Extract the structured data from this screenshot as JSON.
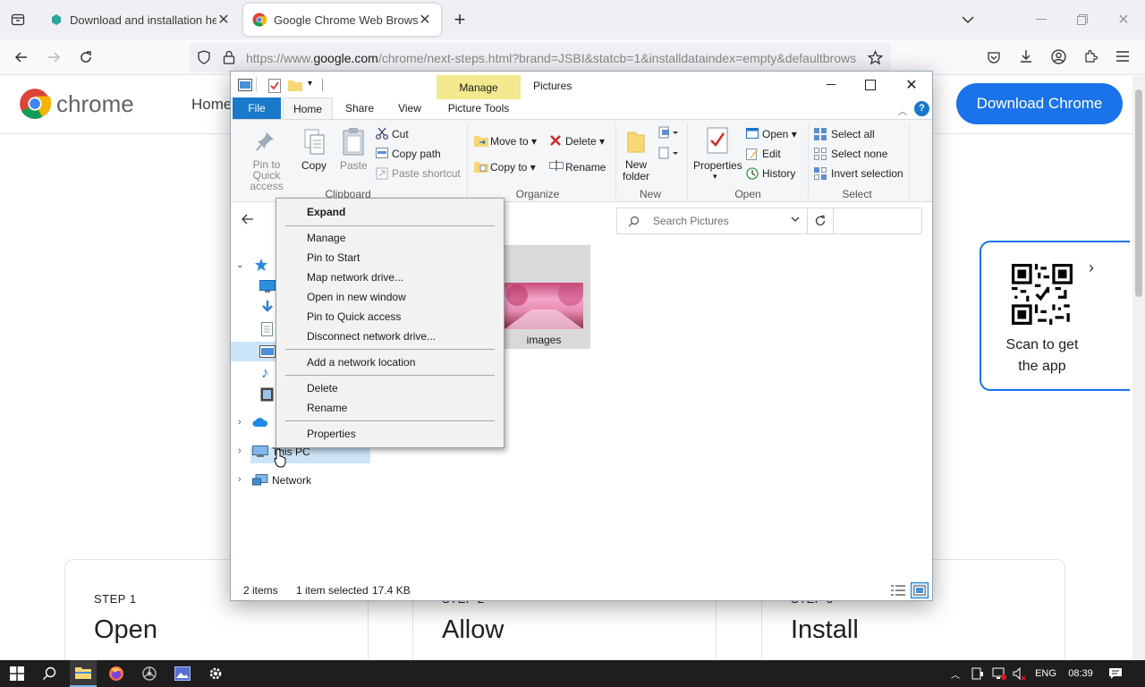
{
  "browser": {
    "tabs": [
      {
        "title": "Download and installation help",
        "active": false
      },
      {
        "title": "Google Chrome Web Browser",
        "active": true
      }
    ],
    "url": {
      "prefix": "https://www.",
      "domain": "google.com",
      "rest": "/chrome/next-steps.html?brand=JSBI&statcb=1&installdataindex=empty&defaultbrows"
    }
  },
  "page": {
    "logo_text": "chrome",
    "nav_home": "Home",
    "download_button": "Download Chrome",
    "qr_text_line1": "Scan to get",
    "qr_text_line2": "the app",
    "steps": [
      {
        "number": "STEP 1",
        "title": "Open"
      },
      {
        "number": "STEP 2",
        "title": "Allow"
      },
      {
        "number": "STEP 3",
        "title": "Install"
      }
    ]
  },
  "explorer": {
    "title": "Pictures",
    "manage_tab": "Manage",
    "ribbon_tabs": [
      "File",
      "Home",
      "Share",
      "View",
      "Picture Tools"
    ],
    "clipboard": {
      "pin": "Pin to Quick access",
      "copy": "Copy",
      "paste": "Paste",
      "cut": "Cut",
      "copy_path": "Copy path",
      "paste_shortcut": "Paste shortcut",
      "group": "Clipboard"
    },
    "organize": {
      "move_to": "Move to",
      "copy_to": "Copy to",
      "delete": "Delete",
      "rename": "Rename",
      "group": "Organize"
    },
    "new": {
      "new_folder_l1": "New",
      "new_folder_l2": "folder",
      "group": "New"
    },
    "open": {
      "properties": "Properties",
      "open": "Open",
      "edit": "Edit",
      "history": "History",
      "group": "Open"
    },
    "select": {
      "select_all": "Select all",
      "select_none": "Select none",
      "invert": "Invert selection",
      "group": "Select"
    },
    "search_placeholder": "Search Pictures",
    "nav": {
      "this_pc": "This PC",
      "network": "Network"
    },
    "folder_item": "images",
    "status": {
      "items": "2 items",
      "selected": "1 item selected",
      "size": "17.4 KB"
    }
  },
  "context_menu": {
    "items": [
      "Expand",
      "Manage",
      "Pin to Start",
      "Map network drive...",
      "Open in new window",
      "Pin to Quick access",
      "Disconnect network drive...",
      "Add a network location",
      "Delete",
      "Rename",
      "Properties"
    ]
  },
  "taskbar": {
    "lang": "ENG",
    "time": "08:39"
  },
  "colors": {
    "accent": "#1a73e8",
    "explorer_blue": "#1979ca",
    "manage_yellow": "#f3e98e"
  }
}
